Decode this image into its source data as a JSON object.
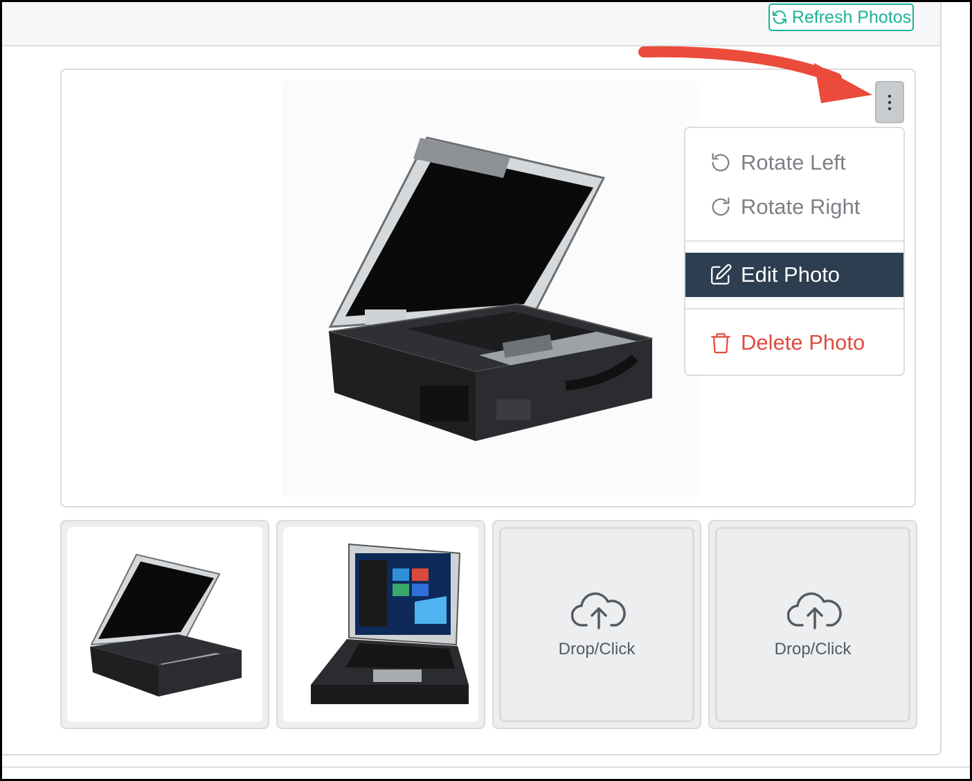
{
  "header": {
    "refresh_label": "Refresh Photos",
    "refresh_icon": "refresh-icon",
    "accent_color": "#1bb394"
  },
  "main_photo": {
    "options_icon": "kebab-icon"
  },
  "menu": {
    "rotate_left": "Rotate Left",
    "rotate_right": "Rotate Right",
    "edit": "Edit Photo",
    "delete": "Delete Photo",
    "edit_bg": "#2c3e50",
    "delete_color": "#e04b3f"
  },
  "thumbnails": [
    {
      "type": "photo"
    },
    {
      "type": "photo"
    },
    {
      "type": "drop",
      "label": "Drop/Click",
      "icon": "upload-cloud-icon"
    },
    {
      "type": "drop",
      "label": "Drop/Click",
      "icon": "upload-cloud-icon"
    }
  ]
}
